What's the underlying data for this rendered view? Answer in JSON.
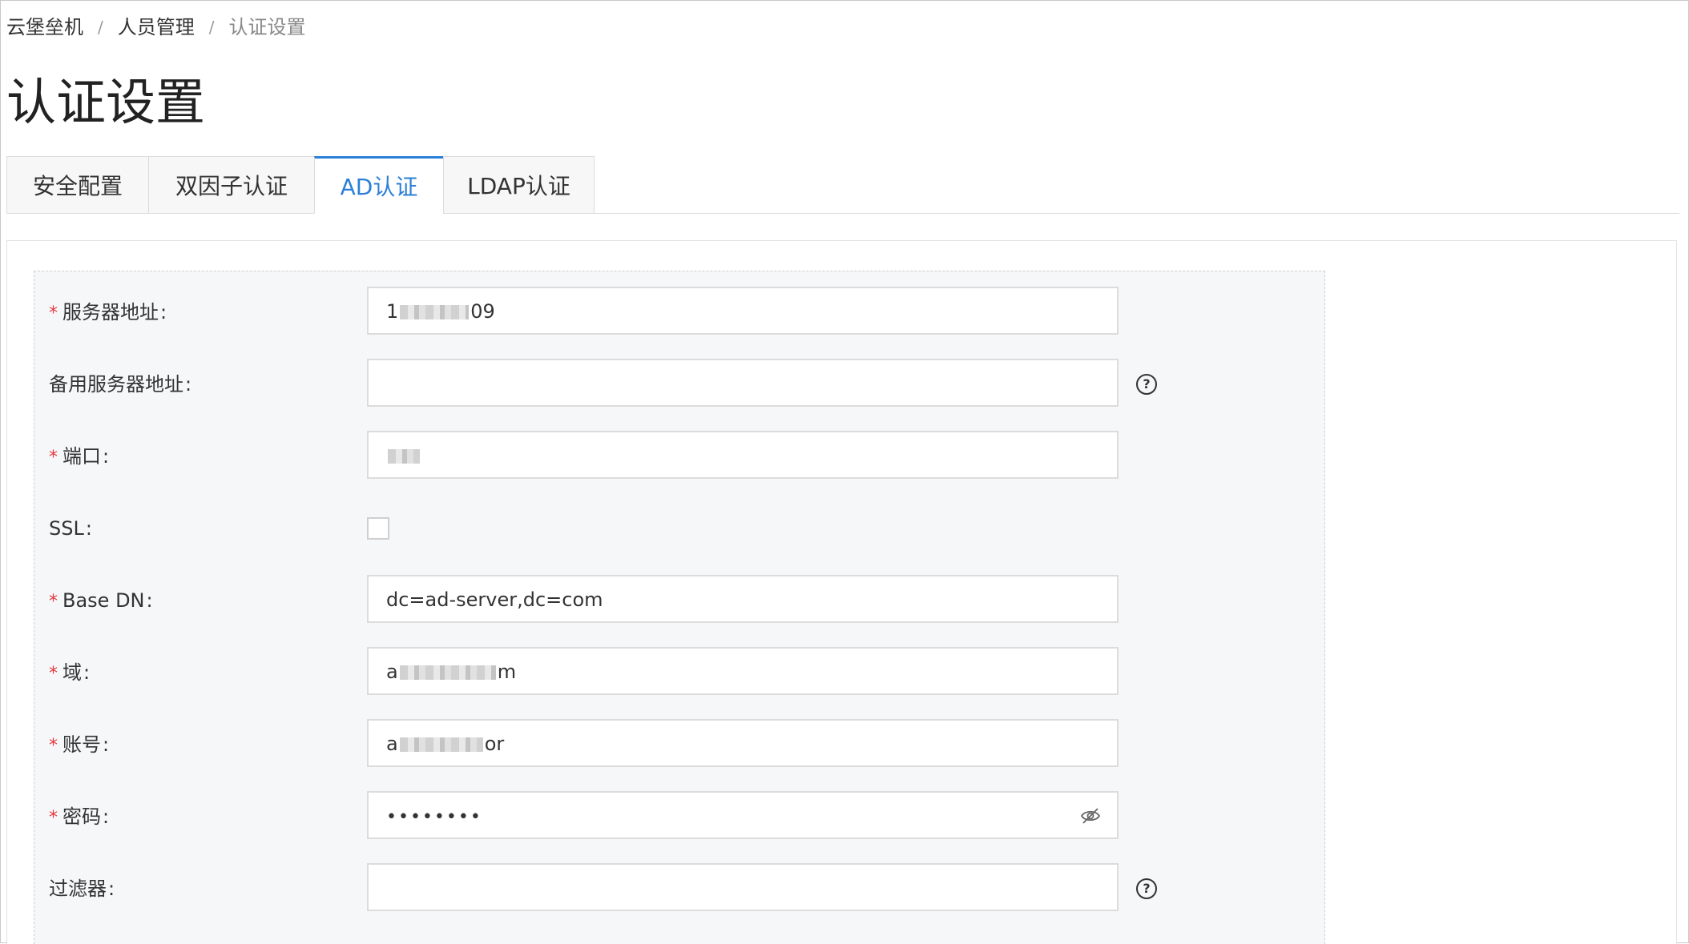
{
  "breadcrumb": {
    "items": [
      "云堡垒机",
      "人员管理"
    ],
    "current": "认证设置",
    "separator": "/"
  },
  "page": {
    "title": "认证设置"
  },
  "tabs": [
    {
      "label": "安全配置",
      "active": false
    },
    {
      "label": "双因子认证",
      "active": false
    },
    {
      "label": "AD认证",
      "active": true
    },
    {
      "label": "LDAP认证",
      "active": false
    }
  ],
  "form": {
    "server_address": {
      "label": "服务器地址",
      "required": true,
      "value_prefix": "1",
      "value_suffix": "09"
    },
    "backup_server": {
      "label": "备用服务器地址",
      "required": false,
      "value": ""
    },
    "port": {
      "label": "端口",
      "required": true
    },
    "ssl": {
      "label": "SSL",
      "checked": false
    },
    "base_dn": {
      "label": "Base DN",
      "required": true,
      "value": "dc=ad-server,dc=com"
    },
    "domain": {
      "label": "域",
      "required": true,
      "value_prefix": "a",
      "value_suffix": "m"
    },
    "account": {
      "label": "账号",
      "required": true,
      "value_prefix": "a",
      "value_suffix": "or"
    },
    "password": {
      "label": "密码",
      "required": true,
      "value": "••••••••"
    },
    "filter": {
      "label": "过滤器",
      "required": false,
      "value": ""
    },
    "required_mark": "*",
    "colon": ":",
    "help_glyph": "?"
  },
  "colors": {
    "accent": "#2b7fd6",
    "required": "#e4393c"
  },
  "icons": [
    "help-icon",
    "eye-slash-icon"
  ]
}
